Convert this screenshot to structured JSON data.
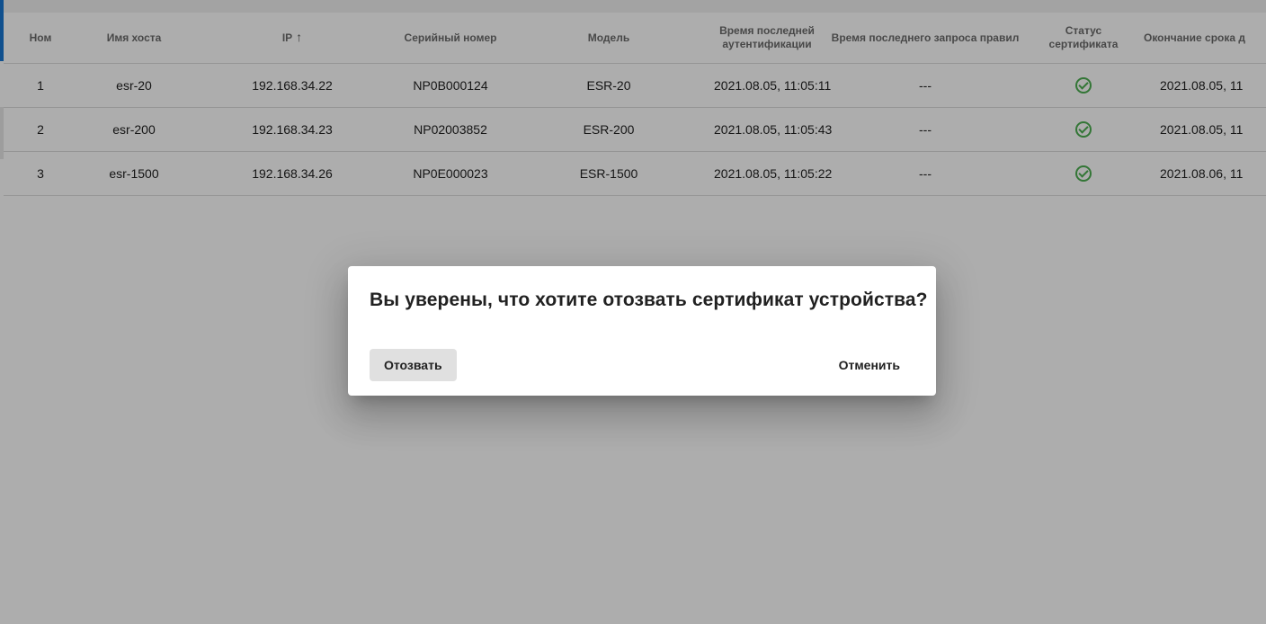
{
  "table": {
    "columns": [
      {
        "label": "Ном"
      },
      {
        "label": "Имя хоста"
      },
      {
        "label": "IP",
        "sort_icon": "arrow-up-icon",
        "sort_glyph": "↑"
      },
      {
        "label": "Серийный номер"
      },
      {
        "label": "Модель"
      },
      {
        "label": "Время последней аутентификации"
      },
      {
        "label": "Время последнего запроса правил"
      },
      {
        "label": "Статус сертификата"
      },
      {
        "label": "Окончание срока д"
      }
    ],
    "rows": [
      {
        "num": "1",
        "host": "esr-20",
        "ip": "192.168.34.22",
        "serial": "NP0B000124",
        "model": "ESR-20",
        "auth_time": "2021.08.05, 11:05:11",
        "rules_time": "---",
        "cert_status_icon": "check-circle-icon",
        "expiry": "2021.08.05, 11"
      },
      {
        "num": "2",
        "host": "esr-200",
        "ip": "192.168.34.23",
        "serial": "NP02003852",
        "model": "ESR-200",
        "auth_time": "2021.08.05, 11:05:43",
        "rules_time": "---",
        "cert_status_icon": "check-circle-icon",
        "expiry": "2021.08.05, 11"
      },
      {
        "num": "3",
        "host": "esr-1500",
        "ip": "192.168.34.26",
        "serial": "NP0E000023",
        "model": "ESR-1500",
        "auth_time": "2021.08.05, 11:05:22",
        "rules_time": "---",
        "cert_status_icon": "check-circle-icon",
        "expiry": "2021.08.06, 11"
      }
    ]
  },
  "dialog": {
    "title": "Вы уверены, что хотите отозвать сертификат устройства?",
    "revoke_label": "Отозвать",
    "cancel_label": "Отменить"
  },
  "colors": {
    "accent": "#1976d2",
    "success": "#4caf50",
    "overlay": "rgba(0,0,0,0.32)"
  }
}
